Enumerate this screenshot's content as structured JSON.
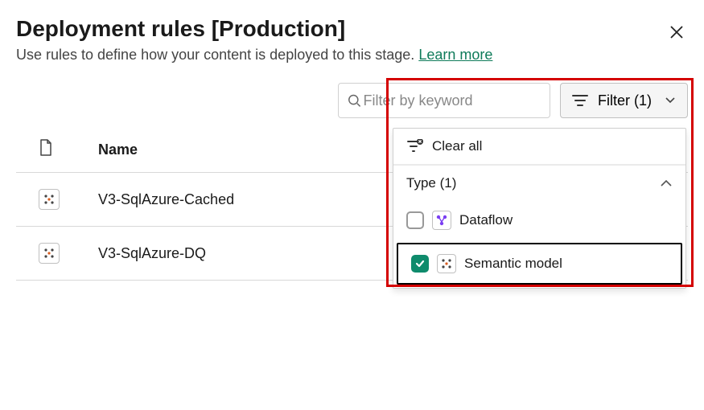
{
  "header": {
    "title": "Deployment rules [Production]",
    "subtitle": "Use rules to define how your content is deployed to this stage.",
    "learn_more": "Learn more"
  },
  "controls": {
    "search_placeholder": "Filter by keyword",
    "filter_button": "Filter (1)"
  },
  "filter_dropdown": {
    "clear_all": "Clear all",
    "group_label": "Type (1)",
    "options": [
      {
        "label": "Dataflow",
        "checked": false
      },
      {
        "label": "Semantic model",
        "checked": true
      }
    ]
  },
  "table": {
    "name_header": "Name",
    "rows": [
      {
        "name": "V3-SqlAzure-Cached"
      },
      {
        "name": "V3-SqlAzure-DQ"
      }
    ]
  }
}
